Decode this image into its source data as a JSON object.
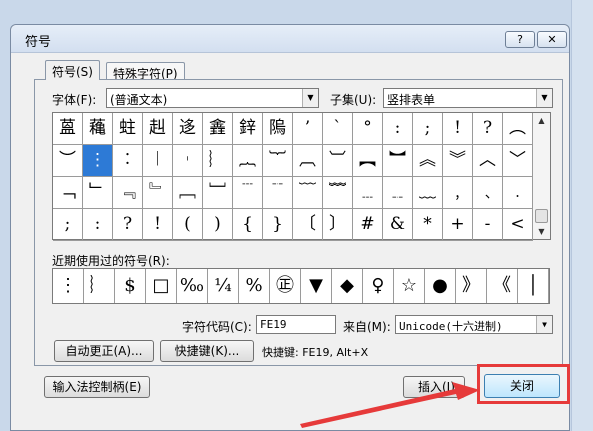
{
  "window": {
    "title": "符号",
    "help_btn": "?",
    "close_btn": "✕"
  },
  "tabs": [
    {
      "label": "符号(S)"
    },
    {
      "label": "特殊字符(P)"
    }
  ],
  "font": {
    "label": "字体(F):",
    "value": "(普通文本)"
  },
  "subset": {
    "label": "子集(U):",
    "value": "竖排表单"
  },
  "grid": {
    "rows": [
      [
        "蒕",
        "蘒",
        "蛀",
        "赳",
        "迻",
        "錱",
        "鋅",
        "隖",
        "’",
        "`",
        "°",
        ":",
        ";",
        "!",
        "?",
        "︵"
      ],
      [
        "︶",
        "⋮",
        "︰",
        "︱",
        "︲",
        "︴",
        "︷",
        "︸",
        "︹",
        "︺",
        "︻",
        "︼",
        "︽",
        "︾",
        "︿",
        "﹀"
      ],
      [
        "﹁",
        "﹂",
        "﹃",
        "﹄",
        "﹇",
        "﹈",
        "﹉",
        "﹊",
        "﹋",
        "﹌",
        "﹍",
        "﹎",
        "﹏",
        "﹐",
        "﹑",
        "﹒"
      ],
      [
        ";",
        ":",
        "?",
        "!",
        "(",
        ")",
        "{",
        "}",
        "〔",
        "〕",
        "#",
        "&",
        "*",
        "+",
        "-",
        "<"
      ]
    ],
    "selected_row": 1,
    "selected_col": 1
  },
  "recent": {
    "label": "近期使用过的符号(R):",
    "items": [
      "⋮",
      "︴",
      "$",
      "□",
      "‰",
      "¼",
      "%",
      "㊣",
      "▼",
      "◆",
      "♀",
      "☆",
      "●",
      "》",
      "《",
      "│"
    ]
  },
  "char_code": {
    "label": "字符代码(C):",
    "value": "FE19"
  },
  "from": {
    "label": "来自(M):",
    "value": "Unicode(十六进制)"
  },
  "autocorrect_btn": "自动更正(A)...",
  "shortcut_btn": "快捷键(K)...",
  "shortcut_text": "快捷键: FE19, Alt+X",
  "ime_btn": "输入法控制柄(E)",
  "insert_btn": "插入(I)",
  "cancel_btn": "关闭",
  "colors": {
    "highlight": "#e63a3a",
    "selection": "#2d7ad6"
  }
}
